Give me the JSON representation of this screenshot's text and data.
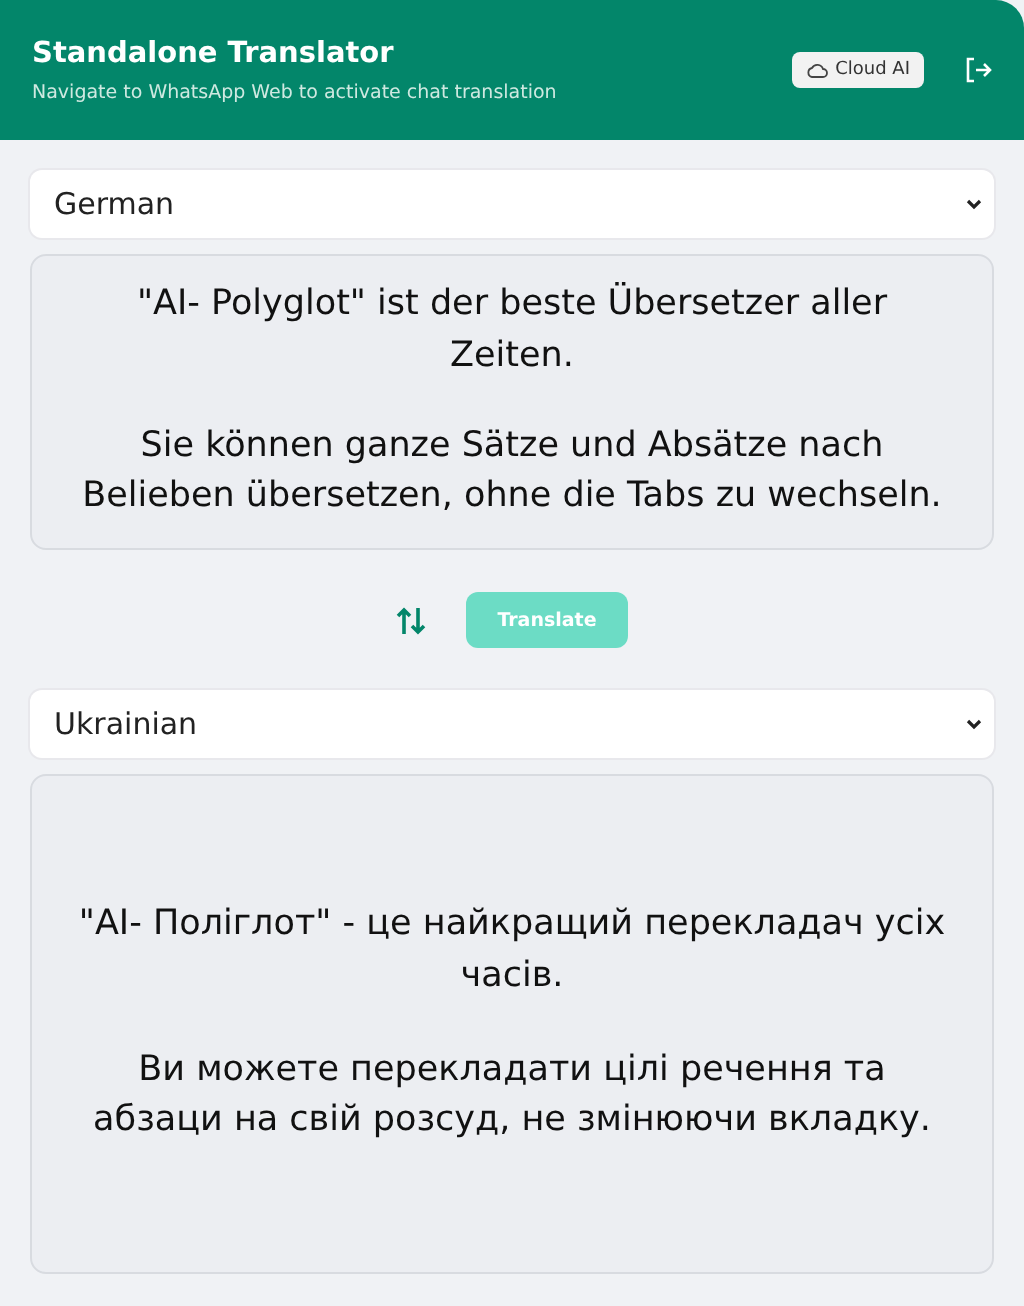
{
  "header": {
    "title": "Standalone Translator",
    "subtitle": "Navigate to WhatsApp Web to activate chat translation",
    "mode_button": "Cloud AI"
  },
  "source": {
    "language": "German",
    "paragraphs": [
      "\"AI- Polyglot\" ist der beste Übersetzer aller Zeiten.",
      "Sie können ganze Sätze und Absätze nach Belieben übersetzen, ohne die Tabs zu wechseln."
    ]
  },
  "actions": {
    "translate_button": "Translate",
    "translate_disabled": true
  },
  "target": {
    "language": "Ukrainian",
    "paragraphs": [
      "\"AI- Поліглот\" - це найкращий перекладач усіх часів.",
      "Ви можете перекладати цілі речення та абзаци на свій розсуд, не змінюючи вкладку."
    ]
  }
}
